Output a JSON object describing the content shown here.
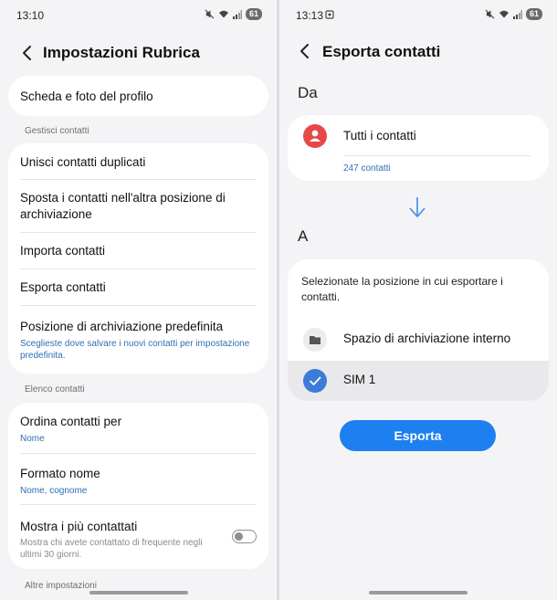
{
  "left": {
    "status": {
      "time": "13:10",
      "battery": "61"
    },
    "title": "Impostazioni Rubrica",
    "profile_card": {
      "label": "Scheda e foto del profilo"
    },
    "section_manage": "Gestisci contatti",
    "manage_items": [
      {
        "label": "Unisci contatti duplicati"
      },
      {
        "label": "Sposta i contatti nell'altra posizione di archiviazione"
      },
      {
        "label": "Importa contatti"
      },
      {
        "label": "Esporta contatti"
      },
      {
        "label": "Posizione di archiviazione predefinita",
        "sub": "Sceglieste dove salvare i nuovi contatti per impostazione predefinita."
      }
    ],
    "section_list": "Elenco contatti",
    "list_items": [
      {
        "label": "Ordina contatti per",
        "sub": "Nome"
      },
      {
        "label": "Formato nome",
        "sub": "Nome, cognome"
      },
      {
        "label": "Mostra i più contattati",
        "sub": "Mostra chi avete contattato di frequente negli ultimi 30 giorni.",
        "toggle_on": false
      }
    ],
    "section_other": "Altre impostazioni"
  },
  "right": {
    "status": {
      "time": "13:13",
      "battery": "61"
    },
    "title": "Esporta contatti",
    "from_label": "Da",
    "source": {
      "label": "Tutti i contatti",
      "count": "247 contatti"
    },
    "to_label": "A",
    "destination_prompt": "Selezionate la posizione in cui esportare i contatti.",
    "destinations": [
      {
        "label": "Spazio di archiviazione interno",
        "icon": "folder-icon",
        "selected": false
      },
      {
        "label": "SIM 1",
        "icon": "check-icon",
        "selected": true
      }
    ],
    "export_button": "Esporta"
  },
  "colors": {
    "accent": "#1e7ff0",
    "link": "#2f6fb5",
    "avatar": "#e6484a",
    "background": "#f4f4f6"
  }
}
